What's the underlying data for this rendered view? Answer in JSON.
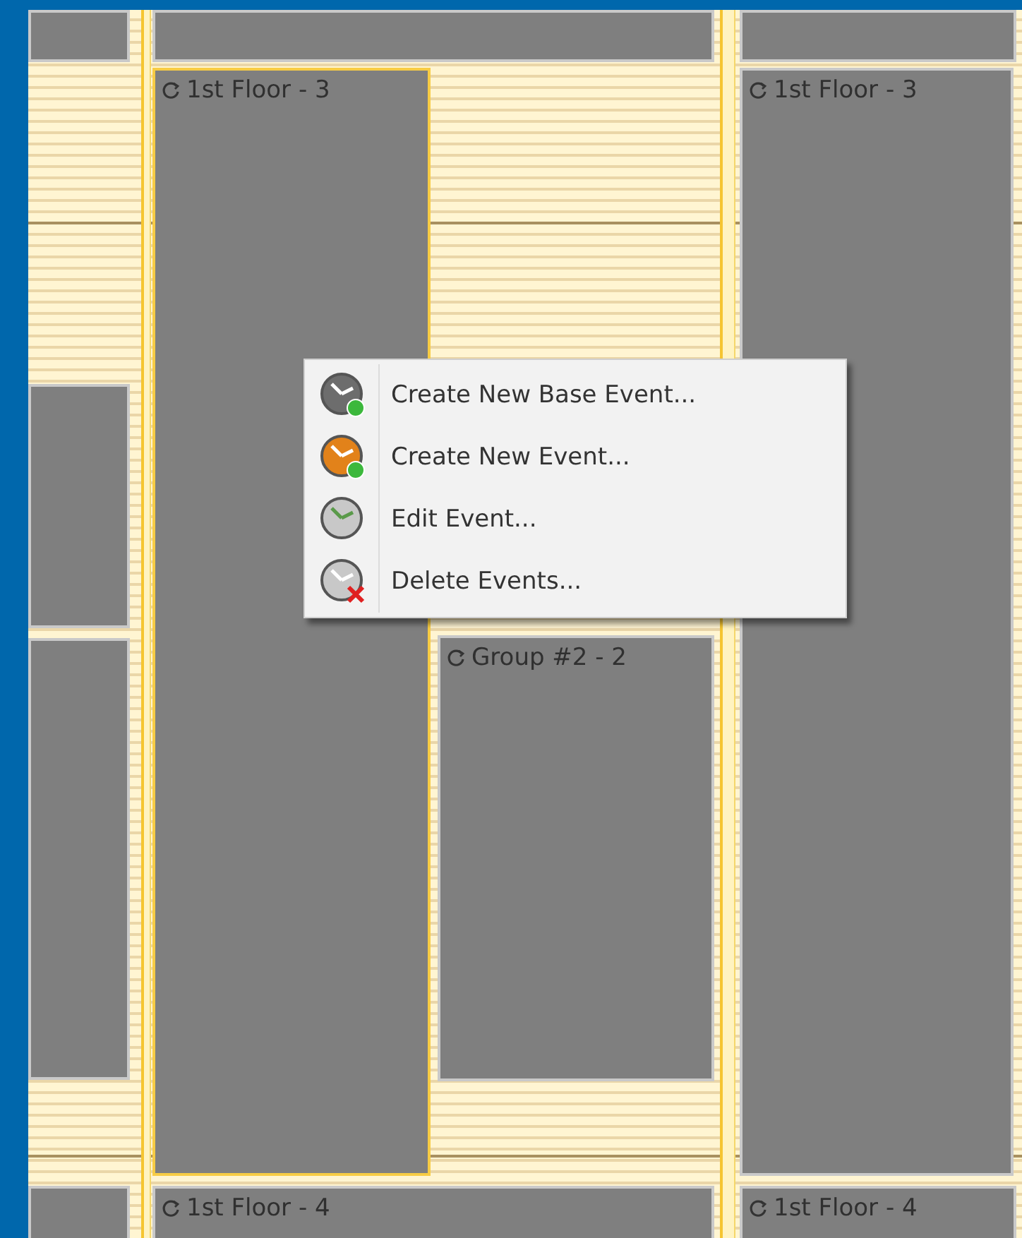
{
  "calendar": {
    "events": [
      {
        "selected": false
      },
      {
        "selected": false
      },
      {
        "selected": false
      },
      {
        "label": "1st Floor - 3",
        "selected": true
      },
      {
        "label": "1st Floor - 3",
        "selected": false
      },
      {
        "selected": false
      },
      {
        "selected": false
      },
      {
        "label": "Group #2 - 2",
        "selected": false
      },
      {
        "selected": false
      },
      {
        "label": "1st Floor - 4",
        "selected": false
      },
      {
        "label": "1st Floor - 4",
        "selected": false
      }
    ]
  },
  "context_menu": {
    "items": [
      {
        "label": "Create New Base Event...",
        "kind": "create-base"
      },
      {
        "label": "Create New Event...",
        "kind": "create"
      },
      {
        "label": "Edit Event...",
        "kind": "edit"
      },
      {
        "label": "Delete Events...",
        "kind": "delete"
      }
    ]
  }
}
